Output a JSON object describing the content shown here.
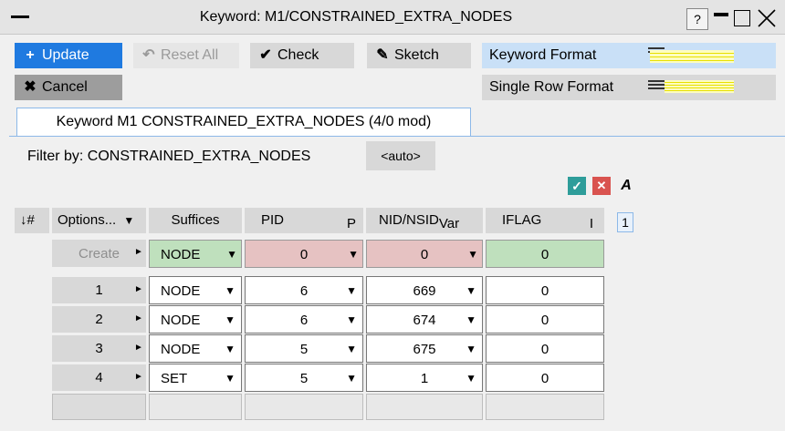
{
  "window": {
    "title": "Keyword: M1/CONSTRAINED_EXTRA_NODES",
    "help_label": "?"
  },
  "toolbar": {
    "update_label": "Update",
    "reset_all_label": "Reset All",
    "check_label": "Check",
    "sketch_label": "Sketch",
    "cancel_label": "Cancel",
    "keyword_format_label": "Keyword Format",
    "single_row_format_label": "Single Row Format"
  },
  "tab": {
    "label": "Keyword M1 CONSTRAINED_EXTRA_NODES (4/0 mod)"
  },
  "filter": {
    "label": "Filter by: CONSTRAINED_EXTRA_NODES",
    "auto_label": "<auto>"
  },
  "icons": {
    "accept": "check-icon",
    "reject": "x-icon",
    "font": "italic-a-icon"
  },
  "table": {
    "headers": {
      "index": "↓#",
      "options": "Options...",
      "options_arrow": "▼",
      "suffices": "Suffices",
      "pid": "PID",
      "pid_tag": "P",
      "nid": "NID/NSID",
      "nid_tag": "Var",
      "iflag": "IFLAG",
      "iflag_tag": "I"
    },
    "create_row": {
      "label": "Create",
      "suffix": "NODE",
      "pid": "0",
      "nid": "0",
      "iflag": "0"
    },
    "rows": [
      {
        "index": "1",
        "suffix": "NODE",
        "pid": "6",
        "nid": "669",
        "iflag": "0"
      },
      {
        "index": "2",
        "suffix": "NODE",
        "pid": "6",
        "nid": "674",
        "iflag": "0"
      },
      {
        "index": "3",
        "suffix": "NODE",
        "pid": "5",
        "nid": "675",
        "iflag": "0"
      },
      {
        "index": "4",
        "suffix": "SET",
        "pid": "5",
        "nid": "1",
        "iflag": "0"
      }
    ],
    "page": "1"
  },
  "colors": {
    "accent_blue": "#1f7ae0",
    "create_red": "#e6c2c2",
    "create_green": "#bfe0bd"
  }
}
